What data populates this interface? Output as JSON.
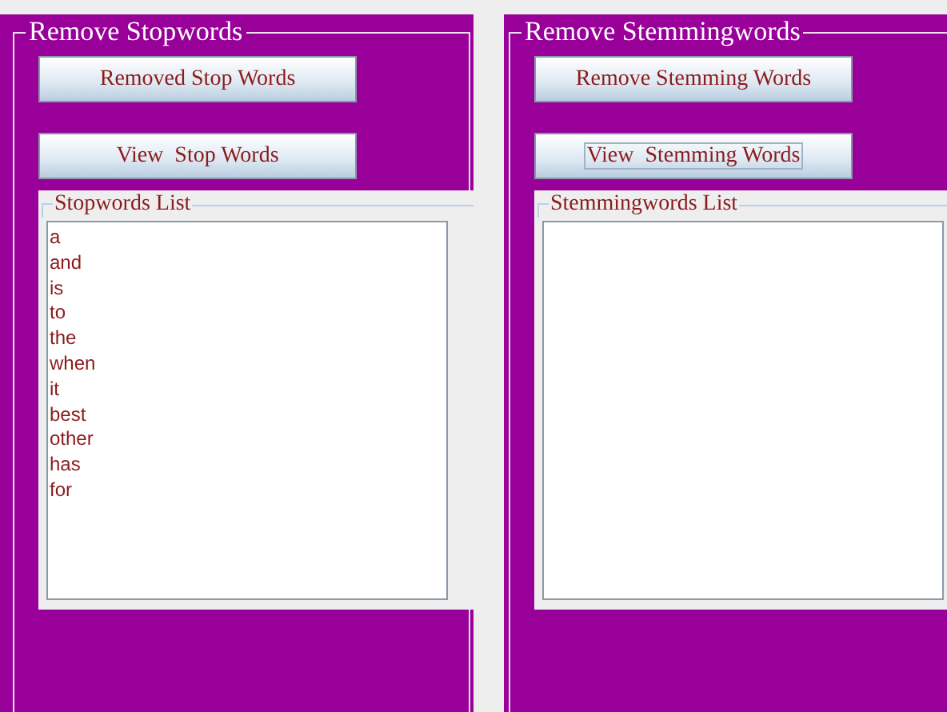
{
  "panels": [
    {
      "title": "Remove Stopwords",
      "buttons": [
        {
          "label": "Removed Stop Words",
          "focused": false
        },
        {
          "label": "View  Stop Words",
          "focused": false
        }
      ],
      "list": {
        "title": "Stopwords List",
        "items": [
          "a",
          "and",
          "is",
          "to",
          "the",
          "when",
          "it",
          "best",
          "other",
          "has",
          "for"
        ]
      }
    },
    {
      "title": "Remove Stemmingwords",
      "buttons": [
        {
          "label": "Remove Stemming Words",
          "focused": false
        },
        {
          "label": "View  Stemming Words",
          "focused": true
        }
      ],
      "list": {
        "title": "Stemmingwords List"
      }
    }
  ]
}
